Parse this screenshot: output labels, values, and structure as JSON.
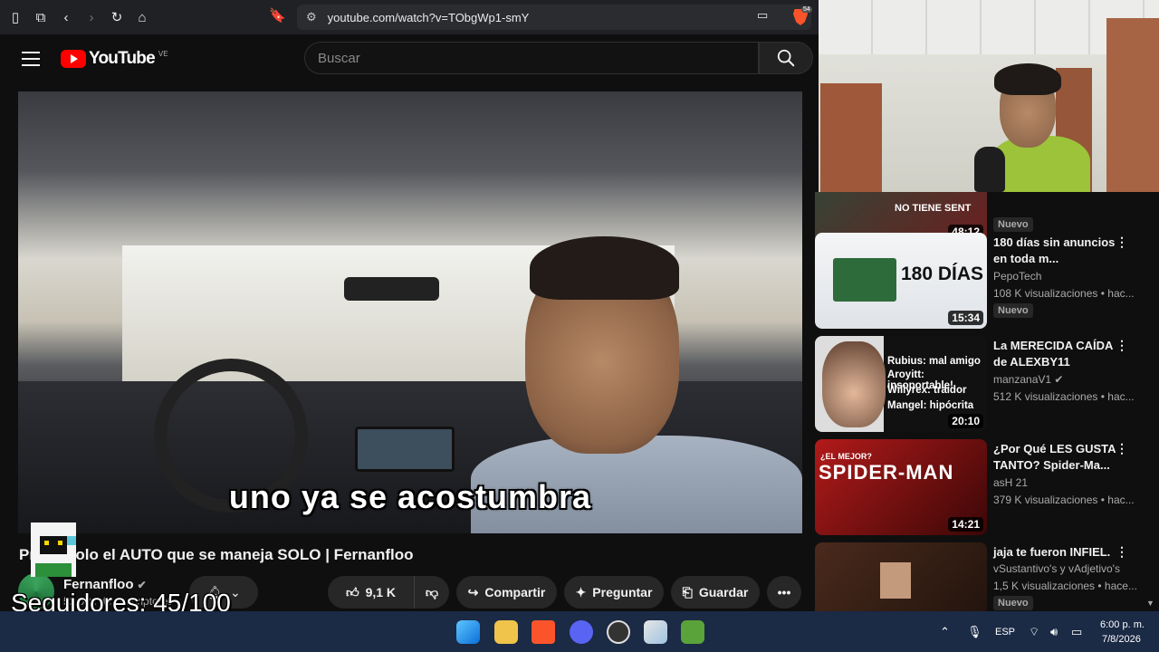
{
  "browser": {
    "url": "youtube.com/watch?v=TObgWp1-smY",
    "shield_count": "54"
  },
  "youtube": {
    "logo_text": "YouTube",
    "country_code": "VE",
    "search_placeholder": "Buscar"
  },
  "video": {
    "caption": "uno ya se acostumbra",
    "title": "Probé solo el AUTO que se maneja SOLO | Fernanfloo",
    "channel": "Fernanfloo",
    "subscribers": "52,9 M de suscriptores",
    "likes": "9,1 K",
    "share_label": "Compartir",
    "ask_label": "Preguntar",
    "save_label": "Guardar"
  },
  "overlay": {
    "followers": "Seguidores: 45/100"
  },
  "sidebar": {
    "items": [
      {
        "title": "",
        "channel": "",
        "meta": "",
        "badge": "Nuevo",
        "duration": "48:12",
        "thumb_text": "NO TIENE SENT"
      },
      {
        "title": "180 días sin anuncios en toda m...",
        "channel": "PepoTech",
        "meta": "108 K visualizaciones • hac...",
        "badge": "Nuevo",
        "duration": "15:34",
        "thumb_text": "180 DÍAS"
      },
      {
        "title": "La MERECIDA CAÍDA de ALEXBY11",
        "channel": "manzanaV1",
        "meta": "512 K visualizaciones • hac...",
        "badge": "",
        "duration": "20:10",
        "thumb_lines": [
          "Rubius: mal amigo",
          "Aroyitt: insoportable!",
          "Willyrex: traidor",
          "Mangel: hipócrita"
        ]
      },
      {
        "title": "¿Por Qué LES GUSTA TANTO? Spider-Ma...",
        "channel": "asH 21",
        "meta": "379 K visualizaciones • hac...",
        "badge": "",
        "duration": "14:21",
        "thumb_text": "SPIDER-MAN",
        "thumb_small": "¿EL MEJOR?"
      },
      {
        "title": "jaja te fueron INFIEL.",
        "channel": "vSustantivo's y vAdjetivo's",
        "meta": "1,5 K visualizaciones • hace...",
        "badge": "Nuevo",
        "duration": "",
        "thumb_text": ""
      }
    ]
  },
  "taskbar": {
    "time": "6:00 p. m.",
    "date": "7/8/2026",
    "language": "ESP"
  }
}
